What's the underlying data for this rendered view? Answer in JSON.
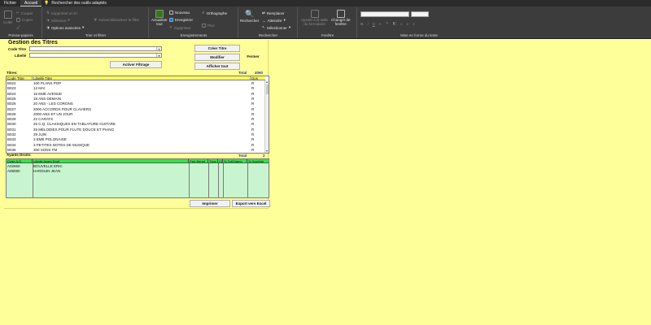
{
  "tabs": [
    {
      "label": "Fichier",
      "active": false
    },
    {
      "label": "Accueil",
      "active": true
    }
  ],
  "tell_me": "Rechercher des outils adaptés",
  "ribbon": {
    "clipboard": {
      "label": "Presse-papiers",
      "paste": "Coller",
      "cut": "Couper",
      "copy": "Copier",
      "format_painter": "Reproduire la mise en forme"
    },
    "sort_filter": {
      "label": "Trier et filtrer",
      "filter": "Filtrer",
      "ascending": "Croissant",
      "descending": "Décroissant",
      "remove_sort": "Supprimer un tri",
      "selection": "Sélection",
      "advanced": "Options avancées",
      "toggle_filter": "Activer/désactiver le filtre"
    },
    "records": {
      "label": "Enregistrements",
      "refresh": "Actualiser",
      "refresh_2": "tout",
      "new": "Nouveau",
      "save": "Enregistrer",
      "delete": "Supprimer",
      "totals": "Totaux",
      "spelling": "Orthographe",
      "more": "Plus"
    },
    "find": {
      "label": "Rechercher",
      "find": "Rechercher",
      "replace": "Remplacer",
      "goto": "Atteindre",
      "select": "Sélectionner"
    },
    "window": {
      "label": "Fenêtre",
      "fit_form": "Ajuster à la taille",
      "fit_form_2": "du formulaire",
      "switch": "Changer de",
      "switch_2": "fenêtre"
    },
    "text_format": {
      "label": "Mise en forme du texte",
      "bold": "G",
      "italic": "I",
      "underline": "S"
    }
  },
  "form": {
    "title": "Gestion des Titres",
    "code_titre_label": "Code Titre",
    "libelle_label": "Libellé",
    "activer_filtrage": "Activer Filtrage",
    "creer_titre": "Créer Titre",
    "modifier": "Modifier",
    "afficher_tout": "Afficher tout",
    "fermer": "Fermer",
    "titres_label": "Titres:",
    "total_label": "Total",
    "total_titres": "4060",
    "titres_columns": [
      "Code Titre",
      "Libellé Titre",
      "Dos"
    ],
    "titres_rows": [
      [
        "B022",
        "100 PLANS POP",
        "R"
      ],
      [
        "B023",
        "12 MAI",
        "R"
      ],
      [
        "B024",
        "15 EME AVENUE",
        "R"
      ],
      [
        "B025",
        "18 ANS DEMAIN",
        "R"
      ],
      [
        "B026",
        "20 ANS - LES CORONS",
        "R"
      ],
      [
        "B027",
        "2000 ACCORDS POUR CLAVIERS",
        "R"
      ],
      [
        "B028",
        "2000 ANS ET UN JOUR",
        "R"
      ],
      [
        "B029",
        "22 CARATS",
        "R"
      ],
      [
        "B030",
        "25 C.Q. CLASSIQUES EN TABLATURE GUITARE",
        "R"
      ],
      [
        "B031",
        "25 MELODIES POUR FLUTE DOUCE ET PIANO",
        "R"
      ],
      [
        "B032",
        "29 JUIN",
        "R"
      ],
      [
        "B033",
        "3 EME POLONAISE",
        "R"
      ],
      [
        "B034",
        "3 PETITES NOTES DE MUSIQUE",
        "R"
      ],
      [
        "B035",
        "300 SONS FM",
        "R"
      ]
    ],
    "ayants_label": "Ayants Droits:",
    "total_ayants": "2",
    "ayants_columns": [
      "Code A.D.",
      "Libellé Ayant Droit",
      "Part Benef",
      "Type",
      "Cl",
      "% Tot/Sdano",
      "% Sociétai"
    ],
    "ayants_rows": [
      [
        "A02650",
        "BOUVELLE ERIC"
      ],
      [
        "A08080",
        "HARDUIN JEAN"
      ]
    ],
    "imprimer": "Imprimer",
    "export_excel": "Export vers Excel"
  }
}
